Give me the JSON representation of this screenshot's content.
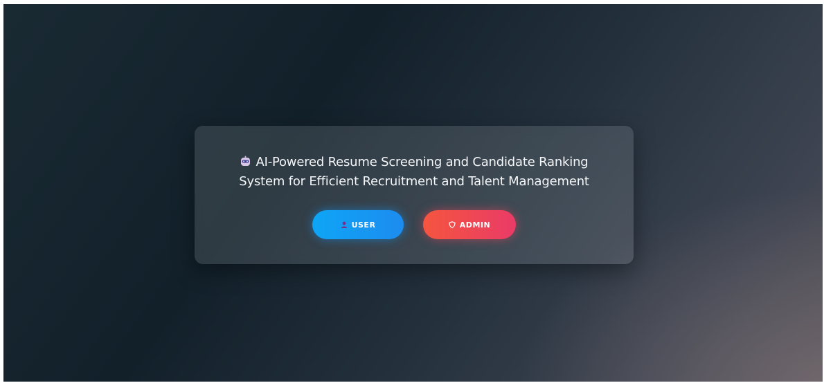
{
  "card": {
    "title_icon": "robot-icon",
    "title_line1": "AI-Powered Resume Screening and Candidate Ranking",
    "title_line2": "System for Efficient Recruitment and Talent Management"
  },
  "buttons": {
    "user": {
      "label": "USER",
      "icon": "person-icon",
      "color": "#0ea5f5"
    },
    "admin": {
      "label": "ADMIN",
      "icon": "shield-icon",
      "color": "#f4553f"
    }
  }
}
